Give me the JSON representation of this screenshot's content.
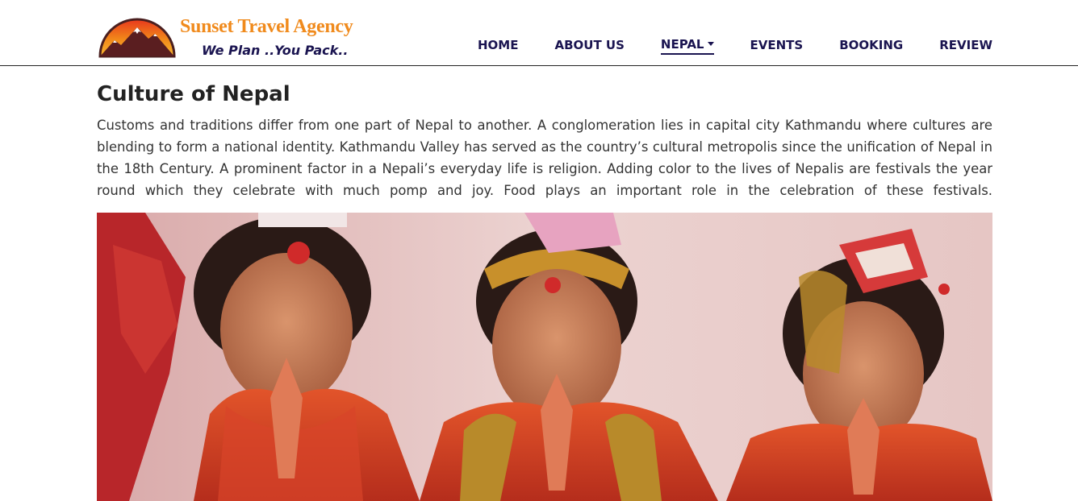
{
  "brand": {
    "name": "Sunset Travel Agency",
    "tagline": "We Plan ..You Pack.."
  },
  "nav": {
    "items": [
      {
        "label": "HOME"
      },
      {
        "label": "ABOUT US"
      },
      {
        "label": "NEPAL"
      },
      {
        "label": "EVENTS"
      },
      {
        "label": "BOOKING"
      },
      {
        "label": "REVIEW"
      }
    ],
    "active": "NEPAL"
  },
  "content": {
    "title": "Culture of Nepal",
    "paragraph": "Customs and traditions differ from one part of Nepal to another. A conglomeration lies in capital city Kathmandu where cultures are blending to form a national identity. Kathmandu Valley has served as the country’s cultural metropolis since the unification of Nepal in the 18th Century. A prominent factor in a Nepali’s everyday life is religion. Adding color to the lives of Nepalis are festivals the year round which they celebrate with much pomp and joy. Food plays an important role in the celebration of these festivals."
  },
  "colors": {
    "brand_orange": "#f08a1c",
    "nav_text": "#1a1450",
    "heading": "#222222",
    "body_text": "#333333"
  },
  "icons": {
    "logo": "sunset-mountain-logo",
    "dropdown": "caret-down-icon"
  }
}
